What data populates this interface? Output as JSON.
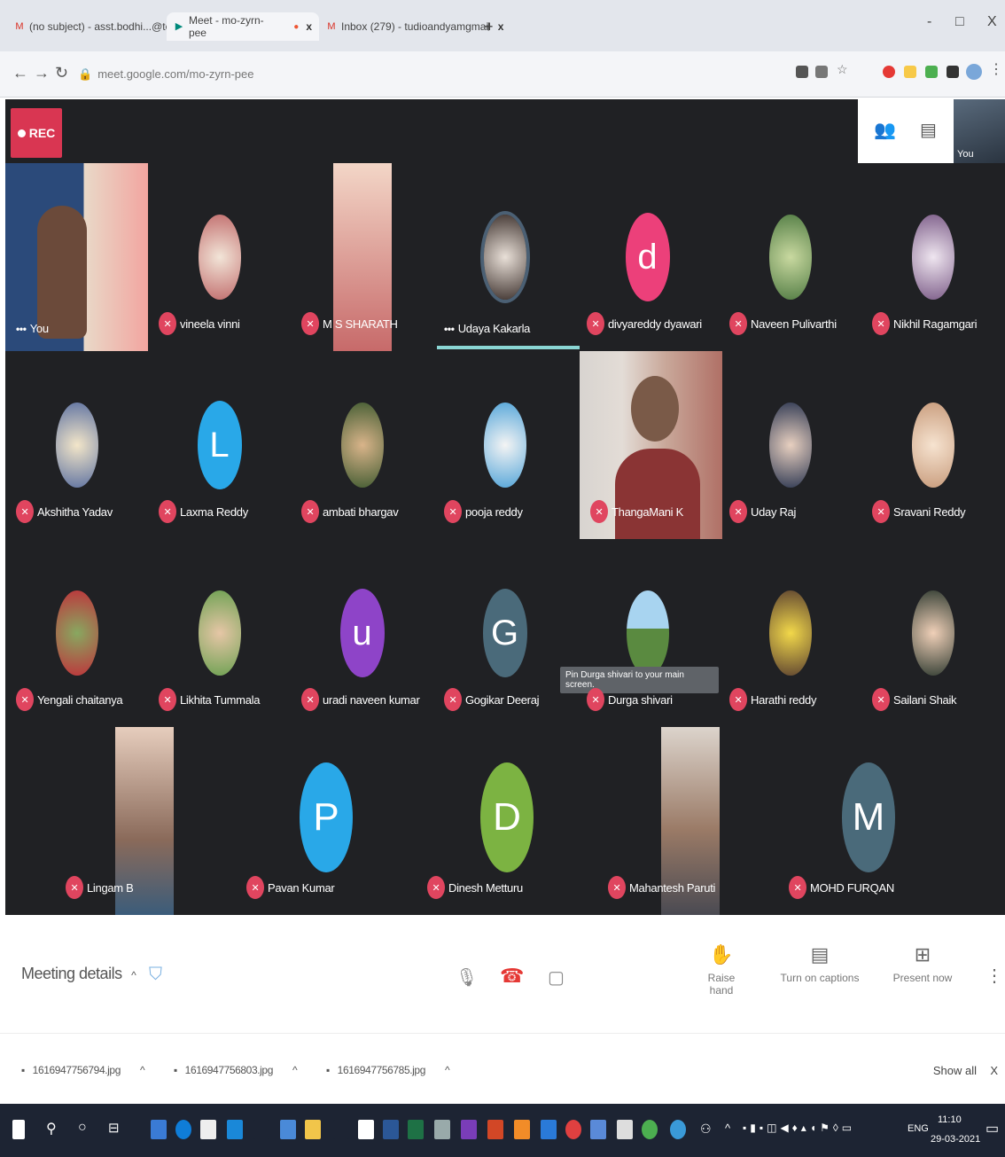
{
  "browser": {
    "tabs": [
      {
        "label": "(no subject) - asst.bodhi...@tc",
        "close": "x"
      },
      {
        "label": "Meet - mo-zyrn-pee",
        "close": "x"
      },
      {
        "label": "Inbox (279) - tudioandyamgmail",
        "close": "x"
      }
    ],
    "new_tab": "+",
    "url": "meet.google.com/mo-zyrn-pee",
    "window_min": "-",
    "window_max": "□",
    "window_close": "X"
  },
  "meeting": {
    "rec_label": "REC",
    "self_label": "You",
    "participants": [
      {
        "name": "You"
      },
      {
        "name": "vineela vinni"
      },
      {
        "name": "M S SHARATH"
      },
      {
        "name": "Udaya Kakarla"
      },
      {
        "name": "divyareddy dyawari",
        "initial": "d"
      },
      {
        "name": "Naveen Pulivarthi"
      },
      {
        "name": "Nikhil Ragamgari"
      },
      {
        "name": "Akshitha Yadav"
      },
      {
        "name": "Laxma Reddy",
        "initial": "L"
      },
      {
        "name": "ambati bhargav"
      },
      {
        "name": "pooja reddy"
      },
      {
        "name": "ThangaMani K"
      },
      {
        "name": "Uday Raj"
      },
      {
        "name": "Sravani Reddy"
      },
      {
        "name": "Yengali chaitanya"
      },
      {
        "name": "Likhita Tummala"
      },
      {
        "name": "uradi naveen kumar",
        "initial": "u"
      },
      {
        "name": "Gogikar Deeraj",
        "initial": "G"
      },
      {
        "name": "Durga shivari"
      },
      {
        "name": "Harathi reddy"
      },
      {
        "name": "Sailani Shaik"
      },
      {
        "name": "Lingam B"
      },
      {
        "name": "Pavan Kumar",
        "initial": "P"
      },
      {
        "name": "Dinesh Metturu",
        "initial": "D"
      },
      {
        "name": "Mahantesh Paruti"
      },
      {
        "name": "MOHD FURQAN",
        "initial": "M"
      }
    ],
    "pin_hint": "Pin Durga shivari to your main screen."
  },
  "controls": {
    "meeting_details": "Meeting details",
    "raise_hand": "Raise hand",
    "captions": "Turn on captions",
    "present": "Present now"
  },
  "downloads": {
    "files": [
      "1616947756794.jpg",
      "1616947756803.jpg",
      "1616947756785.jpg"
    ],
    "show_all": "Show all",
    "close": "X"
  },
  "taskbar": {
    "lang": "ENG",
    "time": "11:10",
    "date": "29-03-2021"
  },
  "colors": {
    "stage_bg": "#202124",
    "mute_red": "#e0455f",
    "rec_red": "#d93652"
  }
}
